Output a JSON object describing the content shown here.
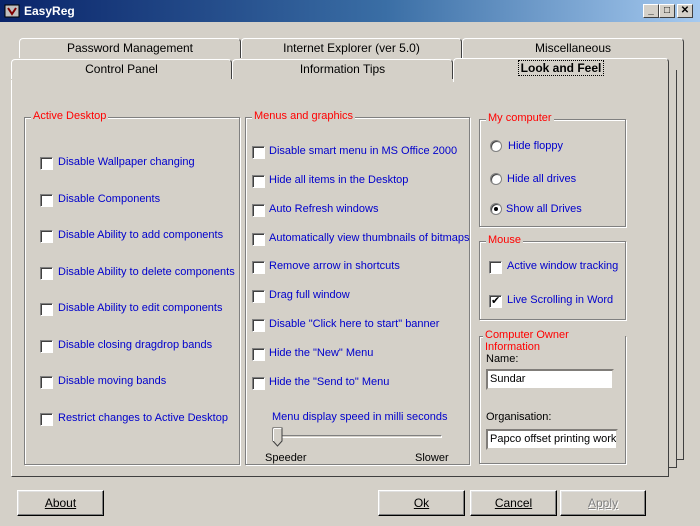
{
  "window": {
    "title": "EasyReg"
  },
  "tabs": {
    "row1": [
      "Password Management",
      "Internet Explorer (ver 5.0)",
      "Miscellaneous"
    ],
    "row2": [
      "Control Panel",
      "Information Tips",
      "Look and Feel"
    ],
    "active": "Look and Feel"
  },
  "active_desktop": {
    "title": "Active Desktop",
    "items": [
      "Disable Wallpaper changing",
      "Disable Components",
      "Disable Ability to add components",
      "Disable Ability to delete components",
      "Disable Ability to edit components",
      "Disable closing dragdrop bands",
      "Disable moving bands",
      "Restrict changes to Active Desktop"
    ]
  },
  "menus": {
    "title": "Menus and graphics",
    "items": [
      "Disable smart menu in MS Office 2000",
      "Hide all items in the Desktop",
      "Auto Refresh windows",
      "Automatically view thumbnails of bitmaps",
      "Remove arrow in shortcuts",
      "Drag full window",
      "Disable \"Click here to start\" banner",
      "Hide the \"New\" Menu",
      "Hide the \"Send to\" Menu"
    ],
    "slider_label": "Menu display speed in milli seconds",
    "slider_min_label": "Speeder",
    "slider_max_label": "Slower",
    "slider_value": 0
  },
  "my_computer": {
    "title": "My computer",
    "options": [
      "Hide floppy",
      "Hide all drives",
      "Show all Drives"
    ],
    "selected": "Show all Drives"
  },
  "mouse": {
    "title": "Mouse",
    "items": [
      {
        "label": "Active window tracking",
        "checked": false
      },
      {
        "label": "Live Scrolling in Word",
        "checked": true
      }
    ]
  },
  "owner": {
    "title": "Computer Owner Information",
    "name_label": "Name:",
    "name_value": "Sundar",
    "org_label": "Organisation:",
    "org_value": "Papco offset printing work"
  },
  "buttons": {
    "about": "About",
    "ok": "Ok",
    "cancel": "Cancel",
    "apply": "Apply"
  },
  "colors": {
    "title_red": "#ff0000",
    "label_blue": "#0000cc"
  }
}
